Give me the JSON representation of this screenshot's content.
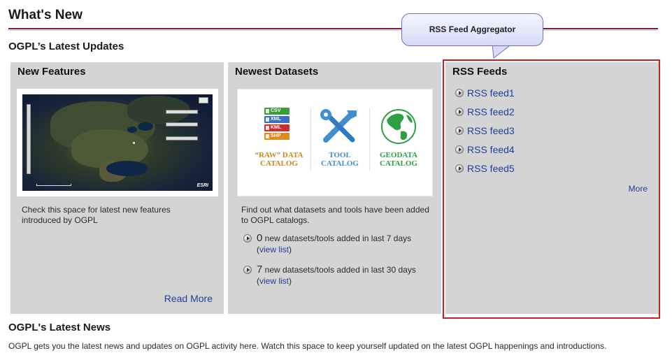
{
  "page": {
    "title": "What's New",
    "subtitle": "OGPL’s Latest Updates"
  },
  "callout": {
    "text": "RSS Feed Aggregator"
  },
  "features": {
    "title": "New Features",
    "description": "Check this space for latest new features introduced by OGPL",
    "read_more": "Read More",
    "map_brand": "ESRI"
  },
  "datasets": {
    "title": "Newest Datasets",
    "description": "Find out what datasets and tools have been added to OGPL catalogs.",
    "catalogs": {
      "raw": {
        "line1": "“RAW” DATA",
        "line2": "CATALOG"
      },
      "tool": {
        "line1": "TOOL",
        "line2": "CATALOG"
      },
      "geo": {
        "line1": "GEODATA",
        "line2": "CATALOG"
      },
      "formats": [
        "CSV",
        "XML",
        "KML",
        "SHP"
      ]
    },
    "stats": [
      {
        "count": "0",
        "text": " new datasets/tools added in last 7 days",
        "link_open": "(",
        "link": "view list",
        "link_close": ")"
      },
      {
        "count": "7",
        "text": " new datasets/tools added in last 30 days",
        "link_open": "(",
        "link": "view list",
        "link_close": ")"
      }
    ]
  },
  "rss": {
    "title": "RSS Feeds",
    "items": [
      "RSS feed1",
      "RSS feed2",
      "RSS feed3",
      "RSS feed4",
      "RSS feed5"
    ],
    "more": "More"
  },
  "news": {
    "title": "OGPL's Latest News",
    "text": "OGPL gets you the latest news and updates on OGPL activity here. Watch this space to keep yourself updated on the latest OGPL happenings and introductions."
  },
  "colors": {
    "link": "#1f3f9a",
    "panel_bg": "#d4d4d4",
    "title_rule": "#8b1a2b",
    "highlight_frame": "#cc1f1f",
    "callout_border": "#6a70c8"
  }
}
